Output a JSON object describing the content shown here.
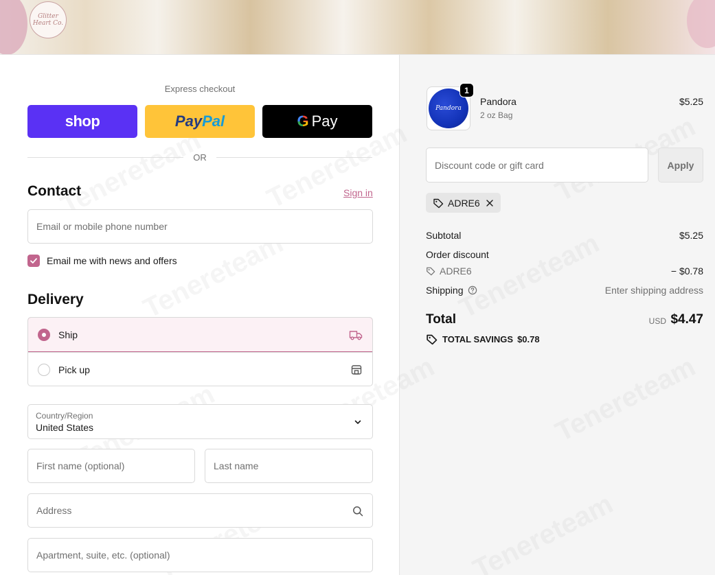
{
  "header": {
    "logo_text": "Glitter Heart Co."
  },
  "express": {
    "title": "Express checkout",
    "shop_label": "shop",
    "paypal_label_1": "Pay",
    "paypal_label_2": "Pal",
    "gpay_g": "G",
    "gpay_label": "Pay",
    "or_text": "OR"
  },
  "contact": {
    "title": "Contact",
    "signin": "Sign in",
    "email_placeholder": "Email or mobile phone number",
    "news_label": "Email me with news and offers",
    "news_checked": true
  },
  "delivery": {
    "title": "Delivery",
    "options": [
      {
        "label": "Ship",
        "selected": true,
        "icon": "truck-icon"
      },
      {
        "label": "Pick up",
        "selected": false,
        "icon": "store-icon"
      }
    ],
    "country_label": "Country/Region",
    "country_value": "United States",
    "first_name_placeholder": "First name (optional)",
    "last_name_placeholder": "Last name",
    "address_placeholder": "Address",
    "apartment_placeholder": "Apartment, suite, etc. (optional)"
  },
  "summary": {
    "product": {
      "name": "Pandora",
      "variant": "2 oz Bag",
      "price": "$5.25",
      "quantity": "1",
      "image_text": "Pandora"
    },
    "discount_placeholder": "Discount code or gift card",
    "apply_label": "Apply",
    "applied_code": "ADRE6",
    "subtotal_label": "Subtotal",
    "subtotal_value": "$5.25",
    "order_discount_label": "Order discount",
    "discount_code": "ADRE6",
    "discount_value": "− $0.78",
    "shipping_label": "Shipping",
    "shipping_value": "Enter shipping address",
    "total_label": "Total",
    "total_currency": "USD",
    "total_value": "$4.47",
    "savings_label": "TOTAL SAVINGS",
    "savings_value": "$0.78"
  },
  "colors": {
    "accent": "#c1658d",
    "shop": "#5a31f4",
    "paypal": "#ffc439",
    "gpay": "#000000",
    "summary_bg": "#f5f5f5"
  },
  "watermark": "Tenereteam"
}
